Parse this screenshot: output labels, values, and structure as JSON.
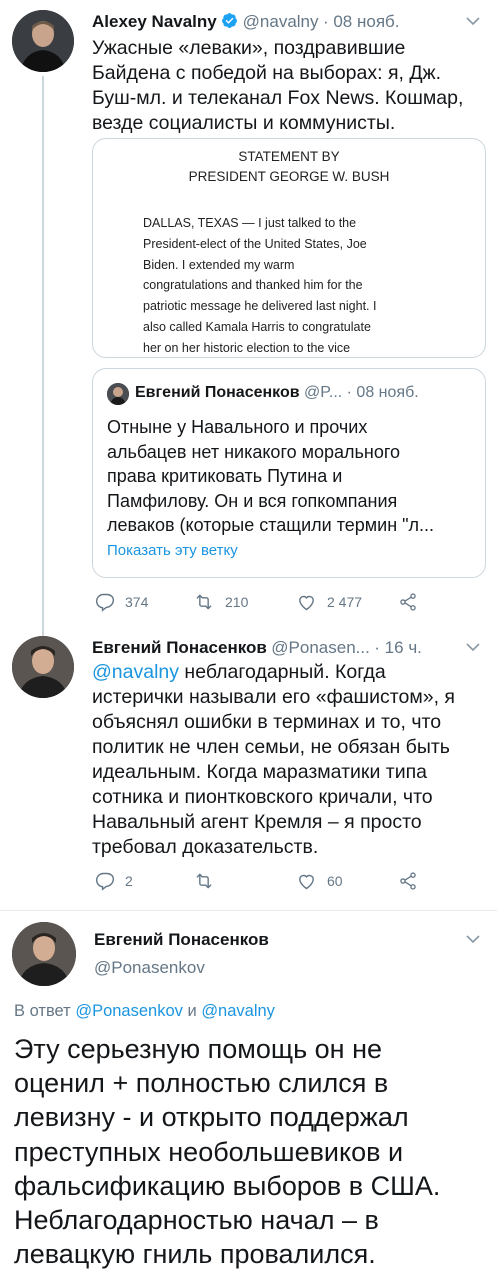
{
  "tweet1": {
    "author": "Alexey Navalny",
    "handle": "@navalny",
    "time": "· 08 нояб.",
    "text_lines": [
      "Ужасные «леваки», поздравившие",
      "Байдена с победой на выборах: я, Дж.",
      "Буш-мл. и телеканал Fox News. Кошмар,",
      "везде социалисты и коммунисты."
    ],
    "statement": {
      "title_lines": [
        "STATEMENT BY",
        "PRESIDENT GEORGE W. BUSH"
      ],
      "body_lines": [
        "DALLAS, TEXAS — I just talked to the",
        "President-elect of the United States, Joe",
        "Biden. I extended my warm",
        "congratulations and thanked him for the",
        "patriotic message he delivered last night. I",
        "also called Kamala Harris to congratulate",
        "her on her historic election to the vice"
      ]
    },
    "quote": {
      "author": "Евгений Понасенков",
      "handle": "@P...",
      "time": "· 08 нояб.",
      "text_lines": [
        "Отныне у Навального и прочих",
        "альбацев нет никакого морального",
        "права критиковать Путина и",
        "Памфилову. Он и вся гопкомпания",
        "леваков (которые стащили термин \"л..."
      ],
      "thread_link": "Показать эту ветку"
    },
    "actions": {
      "replies": "374",
      "retweets": "210",
      "likes": "2 477"
    }
  },
  "tweet2": {
    "author": "Евгений Понасенков",
    "handle": "@Ponasen...",
    "time": "· 16 ч.",
    "mention": "@navalny",
    "text_lines": [
      " неблагодарный. Когда",
      "истерички называли его «фашистом», я",
      "объяснял ошибки в терминах и то, что",
      "политик не член семьи, не обязан быть",
      "идеальным. Когда маразматики типа",
      "сотника и пионтковского кричали, что",
      "Навальный агент Кремля – я просто",
      "требовал доказательств."
    ],
    "actions": {
      "replies": "2",
      "retweets": "",
      "likes": "60"
    }
  },
  "tweet3": {
    "author": "Евгений Понасенков",
    "handle": "@Ponasenkov",
    "reply_prefix": "В ответ",
    "reply_user1": "@Ponasenkov",
    "reply_and": "и",
    "reply_user2": "@navalny",
    "text_lines": [
      "Эту серьезную помощь он не",
      "оценил  + полностью слился в",
      "левизну - и открыто поддержал",
      "преступных необольшевиков и",
      "фальсификацию выборов в США.",
      "Неблагодарностью начал – в",
      "левацкую гниль провалился."
    ]
  },
  "colors": {
    "link": "#1b95e0",
    "secondary": "#657786",
    "verified": "#1da1f2",
    "border": "#ccd6dd"
  }
}
